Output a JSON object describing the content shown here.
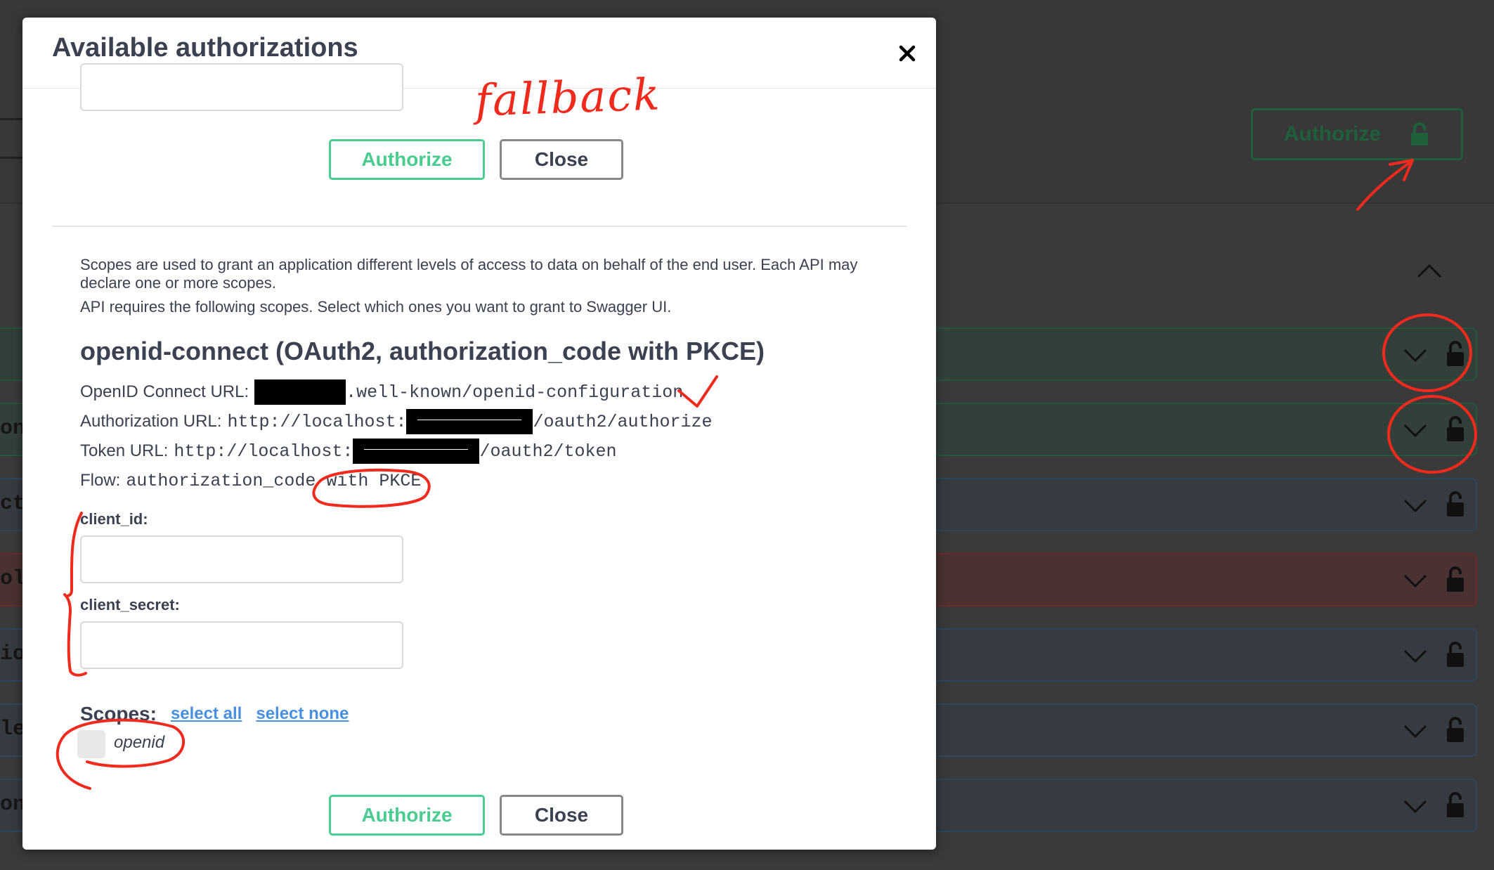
{
  "modal": {
    "title": "Available authorizations",
    "close_icon": "close-icon"
  },
  "top_section": {
    "authorize_label": "Authorize",
    "close_label": "Close"
  },
  "description": {
    "line1": "Scopes are used to grant an application different levels of access to data on behalf of the end user. Each API may declare one or more scopes.",
    "line2": "API requires the following scopes. Select which ones you want to grant to Swagger UI."
  },
  "scheme": {
    "title": "openid-connect (OAuth2, authorization_code with PKCE)",
    "openid_connect_label": "OpenID Connect URL:",
    "openid_connect_url_suffix": ".well-known/openid-configuration",
    "authorization_label": "Authorization URL:",
    "authorization_url_prefix": "http://localhost:",
    "authorization_url_suffix": "/oauth2/authorize",
    "token_label": "Token URL:",
    "token_url_prefix": "http://localhost:",
    "token_url_suffix": "/oauth2/token",
    "flow_label": "Flow:",
    "flow_value": "authorization_code with PKCE"
  },
  "form": {
    "client_id_label": "client_id:",
    "client_id_value": "",
    "client_secret_label": "client_secret:",
    "client_secret_value": ""
  },
  "scopes": {
    "title": "Scopes:",
    "select_all": "select all",
    "select_none": "select none",
    "items": [
      {
        "name": "openid",
        "checked": false
      }
    ]
  },
  "footer": {
    "authorize_label": "Authorize",
    "close_label": "Close"
  },
  "background": {
    "authorize_label": "Authorize",
    "row_side_texts": [
      "",
      "on",
      "cti",
      "olle",
      "io",
      "lec",
      "on c"
    ]
  },
  "annotation": {
    "handwritten_note": "fallback"
  },
  "colors": {
    "authorize_green": "#49cc90",
    "link_blue": "#4990e2",
    "annotation_red": "#f02a1c",
    "text_dark": "#3b4151"
  }
}
